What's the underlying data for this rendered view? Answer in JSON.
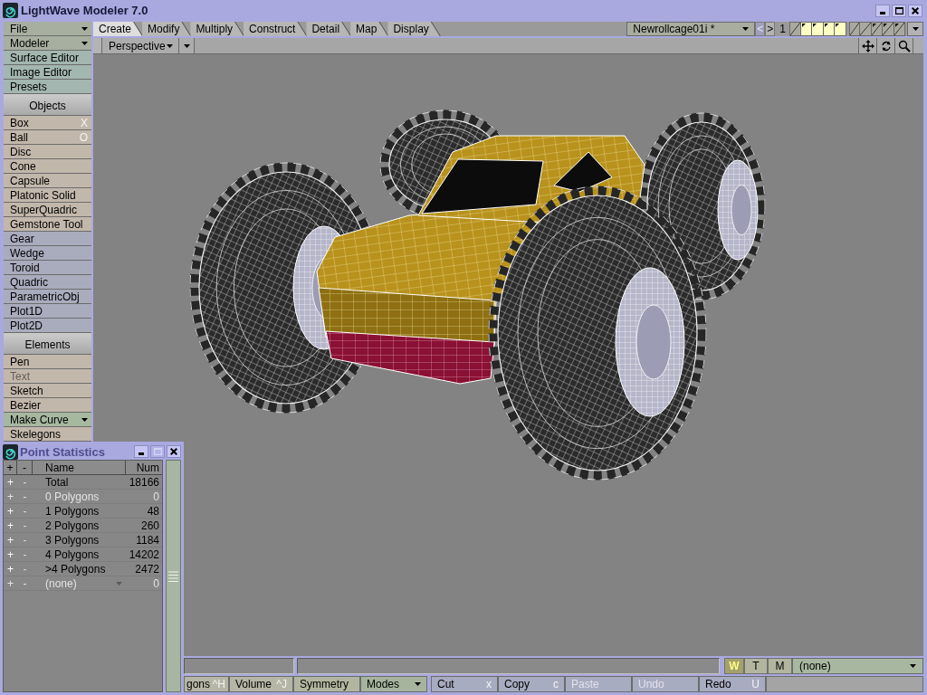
{
  "window": {
    "title": "LightWave Modeler 7.0",
    "active": true,
    "buttons": [
      {
        "kind": "minimize",
        "disabled": false
      },
      {
        "kind": "maximize",
        "disabled": false
      },
      {
        "kind": "close",
        "disabled": false
      }
    ]
  },
  "tabs": [
    {
      "label": "Create",
      "selected": true
    },
    {
      "label": "Modify",
      "selected": false
    },
    {
      "label": "Multiply",
      "selected": false
    },
    {
      "label": "Construct",
      "selected": false
    },
    {
      "label": "Detail",
      "selected": false
    },
    {
      "label": "Map",
      "selected": false
    },
    {
      "label": "Display",
      "selected": false
    }
  ],
  "object_bar": {
    "object": "Newrollcage01i *",
    "prev": {
      "label": "<",
      "disabled": true
    },
    "next": {
      "label": ">",
      "disabled": false
    },
    "bank": "1",
    "layers": [
      {
        "selected": false,
        "has_data": false
      },
      {
        "selected": true,
        "has_data": true
      },
      {
        "selected": true,
        "has_data": true
      },
      {
        "selected": true,
        "has_data": true
      },
      {
        "selected": true,
        "has_data": true
      },
      {
        "selected": false,
        "has_data": false
      },
      {
        "selected": false,
        "has_data": false
      },
      {
        "selected": false,
        "has_data": true
      },
      {
        "selected": false,
        "has_data": true
      },
      {
        "selected": false,
        "has_data": true
      }
    ]
  },
  "view_bar": {
    "view": "Perspective"
  },
  "sidebar": {
    "top_items": [
      {
        "label": "File",
        "kind": "dropdown",
        "color": "#a7afa0"
      },
      {
        "label": "Modeler",
        "kind": "dropdown",
        "color": "#a7afa0"
      },
      {
        "label": "Surface Editor",
        "kind": "button",
        "color": "#a3b6b0"
      },
      {
        "label": "Image Editor",
        "kind": "button",
        "color": "#a3b6b0"
      },
      {
        "label": "Presets",
        "kind": "button",
        "color": "#a3b6b0"
      }
    ],
    "sections": [
      {
        "title": "Objects",
        "items": [
          {
            "label": "Box",
            "shortcut": "X",
            "kind": "button",
            "disabled": false,
            "color": "#c2b7ab"
          },
          {
            "label": "Ball",
            "shortcut": "O",
            "kind": "button",
            "disabled": false,
            "color": "#c2b7ab"
          },
          {
            "label": "Disc",
            "kind": "button",
            "disabled": false,
            "color": "#c2b7ab"
          },
          {
            "label": "Cone",
            "kind": "button",
            "disabled": false,
            "color": "#c2b7ab"
          },
          {
            "label": "Capsule",
            "kind": "button",
            "disabled": false,
            "color": "#c2b7ab"
          },
          {
            "label": "Platonic Solid",
            "kind": "button",
            "disabled": false,
            "color": "#c2b7ab"
          },
          {
            "label": "SuperQuadric",
            "kind": "button",
            "disabled": false,
            "color": "#c2b7ab"
          },
          {
            "label": "Gemstone Tool",
            "kind": "button",
            "disabled": false,
            "color": "#c2b7ab"
          },
          {
            "label": "Gear",
            "kind": "button",
            "disabled": false,
            "color": "#a9acbd"
          },
          {
            "label": "Wedge",
            "kind": "button",
            "disabled": false,
            "color": "#a9acbd"
          },
          {
            "label": "Toroid",
            "kind": "button",
            "disabled": false,
            "color": "#a9acbd"
          },
          {
            "label": "Quadric",
            "kind": "button",
            "disabled": false,
            "color": "#a9acbd"
          },
          {
            "label": "ParametricObj",
            "kind": "button",
            "disabled": false,
            "color": "#a9acbd"
          },
          {
            "label": "Plot1D",
            "kind": "button",
            "disabled": false,
            "color": "#a9acbd"
          },
          {
            "label": "Plot2D",
            "kind": "button",
            "disabled": false,
            "color": "#a9acbd"
          }
        ]
      },
      {
        "title": "Elements",
        "items": [
          {
            "label": "Pen",
            "kind": "button",
            "disabled": false,
            "color": "#c2b7ab"
          },
          {
            "label": "Text",
            "kind": "button",
            "disabled": true,
            "color": "#c2b7ab"
          },
          {
            "label": "Sketch",
            "kind": "button",
            "disabled": false,
            "color": "#c2b7ab"
          },
          {
            "label": "Bezier",
            "kind": "button",
            "disabled": false,
            "color": "#c2b7ab"
          },
          {
            "label": "Make Curve",
            "kind": "dropdown",
            "disabled": false,
            "color": "#a6b8a0"
          },
          {
            "label": "Skelegons",
            "kind": "button",
            "disabled": false,
            "color": "#c2b7ab"
          }
        ]
      }
    ]
  },
  "point_statistics": {
    "title": "Point Statistics",
    "active": false,
    "buttons": [
      {
        "kind": "minimize",
        "disabled": false
      },
      {
        "kind": "maximize",
        "disabled": true
      },
      {
        "kind": "close",
        "disabled": false
      }
    ],
    "columns": [
      "+",
      "-",
      "Name",
      "Num"
    ],
    "rows": [
      {
        "plus": "+",
        "minus": "-",
        "name": "Total",
        "num": "18166",
        "kind": "count",
        "disabled": false
      },
      {
        "plus": "+",
        "minus": "-",
        "name": "0 Polygons",
        "num": "0",
        "kind": "count",
        "disabled": true
      },
      {
        "plus": "+",
        "minus": "-",
        "name": "1 Polygons",
        "num": "48",
        "kind": "count",
        "disabled": false
      },
      {
        "plus": "+",
        "minus": "-",
        "name": "2 Polygons",
        "num": "260",
        "kind": "count",
        "disabled": false
      },
      {
        "plus": "+",
        "minus": "-",
        "name": "3 Polygons",
        "num": "1184",
        "kind": "count",
        "disabled": false
      },
      {
        "plus": "+",
        "minus": "-",
        "name": "4 Polygons",
        "num": "14202",
        "kind": "count",
        "disabled": false
      },
      {
        "plus": "+",
        "minus": "-",
        "name": ">4 Polygons",
        "num": "2472",
        "kind": "count",
        "disabled": false
      },
      {
        "plus": "+",
        "minus": "-",
        "name": "(none)",
        "num": "0",
        "kind": "dropdown",
        "disabled": true
      }
    ]
  },
  "bottom_bar": {
    "modes": [
      {
        "label": "W",
        "selected": true
      },
      {
        "label": "T",
        "selected": false
      },
      {
        "label": "M",
        "selected": false
      }
    ],
    "layer_select": "(none)",
    "buttons": [
      {
        "label": "gons",
        "shortcut": "^H",
        "kind": "button",
        "disabled": false,
        "color": "#b6b6a6"
      },
      {
        "label": "Volume",
        "shortcut": "^J",
        "kind": "button",
        "disabled": false,
        "color": "#b6b6a6"
      },
      {
        "label": "Symmetry",
        "kind": "button",
        "disabled": false,
        "color": "#b2b6a0"
      },
      {
        "label": "Modes",
        "kind": "dropdown",
        "disabled": false,
        "color": "#a6b49e"
      },
      {
        "label": "Cut",
        "shortcut": "x",
        "kind": "button",
        "disabled": false,
        "color": "#a8acc0"
      },
      {
        "label": "Copy",
        "shortcut": "c",
        "kind": "button",
        "disabled": false,
        "color": "#a8acc0"
      },
      {
        "label": "Paste",
        "kind": "button",
        "disabled": true,
        "color": "#a8acc0"
      },
      {
        "label": "Undo",
        "kind": "button",
        "disabled": true,
        "color": "#a8acc0"
      },
      {
        "label": "Redo",
        "shortcut": "U",
        "kind": "button",
        "disabled": false,
        "color": "#a8acc0"
      }
    ]
  }
}
